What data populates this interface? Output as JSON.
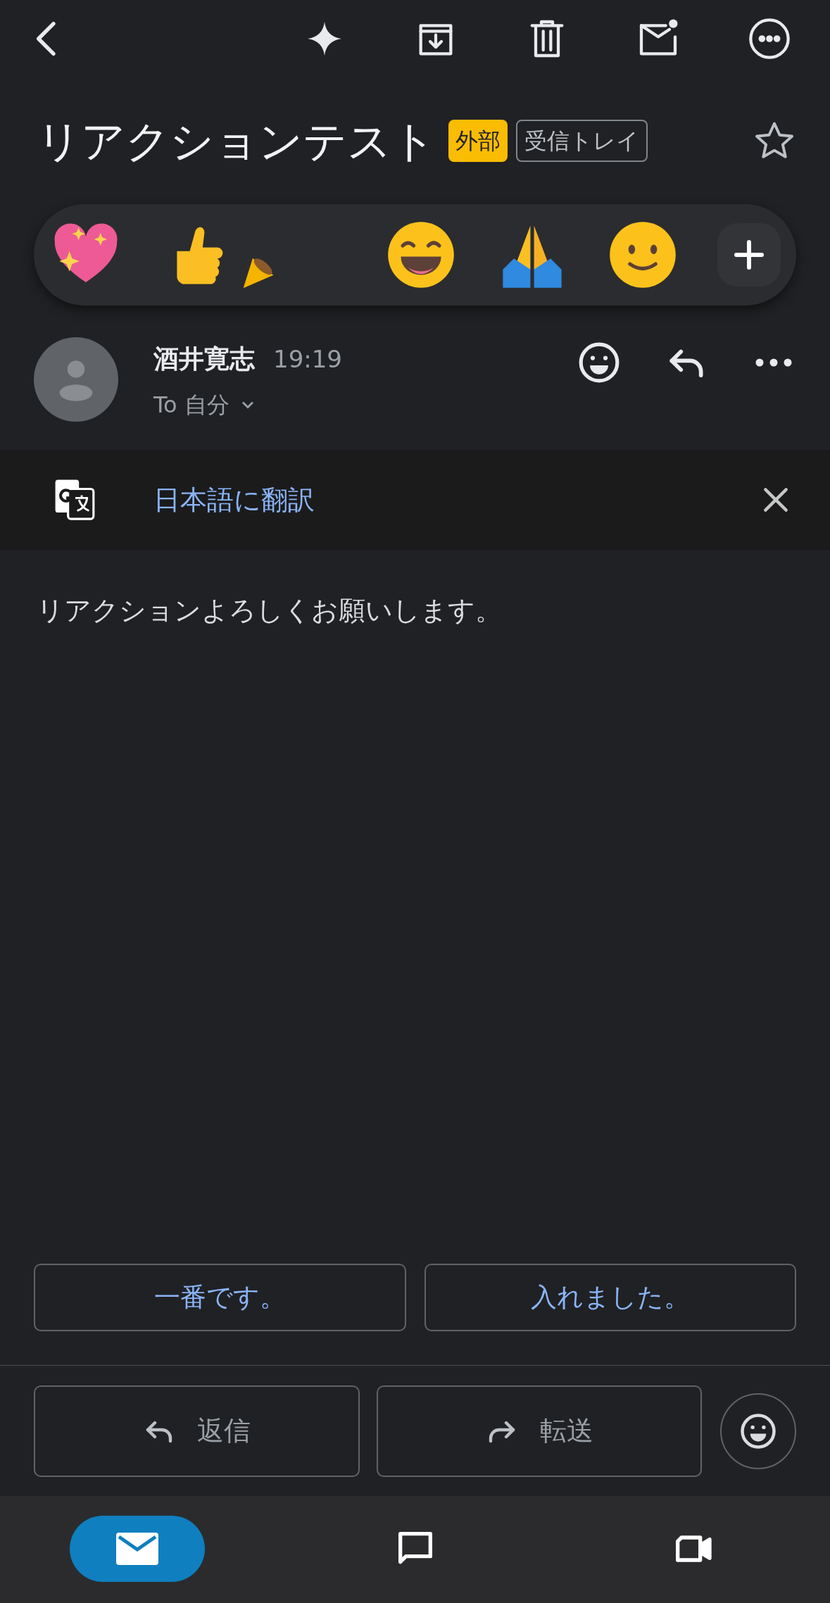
{
  "subject": {
    "title": "リアクションテスト",
    "labels": [
      {
        "text": "外部",
        "kind": "external"
      },
      {
        "text": "受信トレイ",
        "kind": "folder"
      }
    ],
    "starred": false
  },
  "message": {
    "sender": "酒井寛志",
    "time": "19:19",
    "recipient": "To 自分"
  },
  "translate_bar": {
    "link": "日本語に翻訳"
  },
  "body": "リアクションよろしくお願いします。",
  "smart_replies": [
    "一番です。",
    "入れました。"
  ],
  "actions": [
    {
      "kind": "reply",
      "label": "返信"
    },
    {
      "kind": "forward",
      "label": "転送"
    }
  ],
  "bottom_nav": [
    {
      "kind": "mail",
      "selected": true
    },
    {
      "kind": "chat",
      "selected": false
    },
    {
      "kind": "meet",
      "selected": false
    }
  ]
}
